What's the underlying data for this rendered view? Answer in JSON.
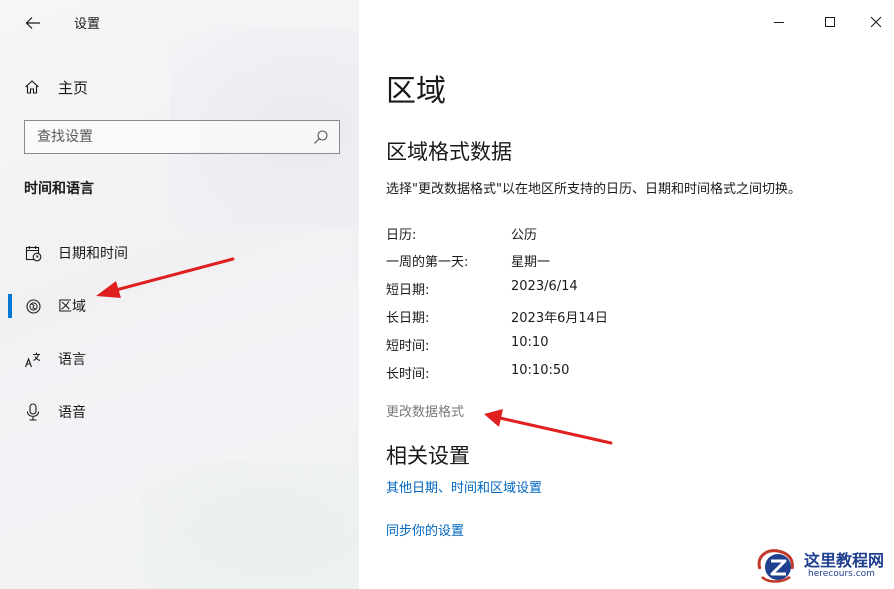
{
  "window": {
    "title": "设置",
    "controls": {
      "minimize": "minimize-icon",
      "maximize": "maximize-icon",
      "close": "close-icon"
    }
  },
  "sidebar": {
    "home_label": "主页",
    "search_placeholder": "查找设置",
    "section_title": "时间和语言",
    "items": [
      {
        "label": "日期和时间",
        "icon": "calendar-clock-icon",
        "selected": false
      },
      {
        "label": "区域",
        "icon": "globe-icon",
        "selected": true
      },
      {
        "label": "语言",
        "icon": "language-icon",
        "selected": false
      },
      {
        "label": "语音",
        "icon": "microphone-icon",
        "selected": false
      }
    ]
  },
  "main": {
    "title": "区域",
    "format_section": {
      "heading": "区域格式数据",
      "description": "选择\"更改数据格式\"以在地区所支持的日历、日期和时间格式之间切换。",
      "rows": [
        {
          "key": "日历:",
          "value": "公历"
        },
        {
          "key": "一周的第一天:",
          "value": "星期一"
        },
        {
          "key": "短日期:",
          "value": "2023/6/14"
        },
        {
          "key": "长日期:",
          "value": "2023年6月14日"
        },
        {
          "key": "短时间:",
          "value": "10:10"
        },
        {
          "key": "长时间:",
          "value": "10:10:50"
        }
      ],
      "change_link": "更改数据格式"
    },
    "related_section": {
      "heading": "相关设置",
      "links": [
        "其他日期、时间和区域设置",
        "同步你的设置"
      ]
    }
  },
  "watermark": {
    "title": "这里教程网",
    "subtitle": "herecours.com"
  },
  "colors": {
    "accent": "#0078d4",
    "link": "#0067c0",
    "annotation_arrow": "#e02020"
  }
}
